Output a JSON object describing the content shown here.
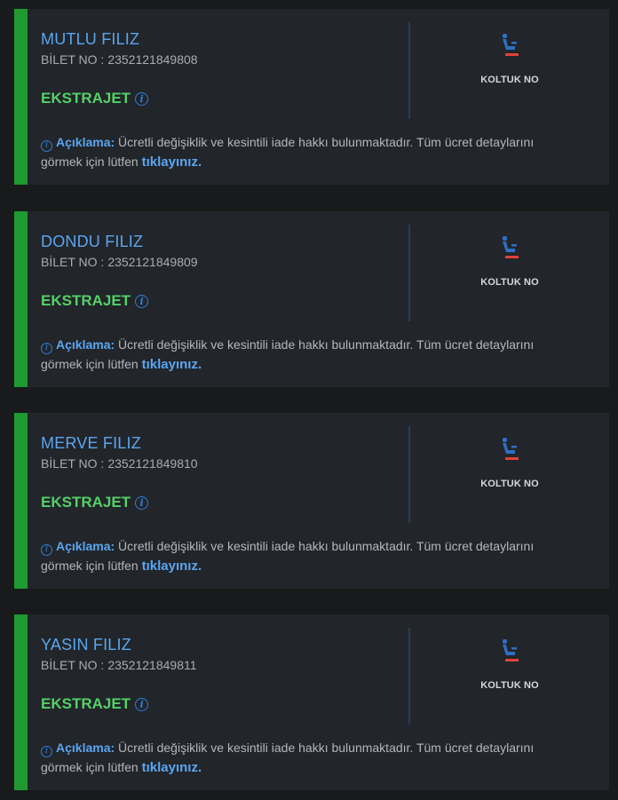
{
  "passengers": [
    {
      "name": "MUTLU FILIZ",
      "ticket_label": "BİLET NO :",
      "ticket_no": "2352121849808",
      "fare_class": "EKSTRAJET",
      "seat_label": "KOLTUK NO",
      "desc_title": "Açıklama:",
      "desc_text": "Ücretli değişiklik ve kesintili iade hakkı bulunmaktadır. Tüm ücret detaylarını görmek için lütfen",
      "desc_link": "tıklayınız."
    },
    {
      "name": "DONDU FILIZ",
      "ticket_label": "BİLET NO :",
      "ticket_no": "2352121849809",
      "fare_class": "EKSTRAJET",
      "seat_label": "KOLTUK NO",
      "desc_title": "Açıklama:",
      "desc_text": "Ücretli değişiklik ve kesintili iade hakkı bulunmaktadır. Tüm ücret detaylarını görmek için lütfen",
      "desc_link": "tıklayınız."
    },
    {
      "name": "MERVE FILIZ",
      "ticket_label": "BİLET NO :",
      "ticket_no": "2352121849810",
      "fare_class": "EKSTRAJET",
      "seat_label": "KOLTUK NO",
      "desc_title": "Açıklama:",
      "desc_text": "Ücretli değişiklik ve kesintili iade hakkı bulunmaktadır. Tüm ücret detaylarını görmek için lütfen",
      "desc_link": "tıklayınız."
    },
    {
      "name": "YASIN FILIZ",
      "ticket_label": "BİLET NO :",
      "ticket_no": "2352121849811",
      "fare_class": "EKSTRAJET",
      "seat_label": "KOLTUK NO",
      "desc_title": "Açıklama:",
      "desc_text": "Ücretli değişiklik ve kesintili iade hakkı bulunmaktadır. Tüm ücret detaylarını görmek için lütfen",
      "desc_link": "tıklayınız."
    }
  ],
  "icons": {
    "seat": "seat-icon",
    "info": "info-icon"
  },
  "colors": {
    "accent": "#1e9a30",
    "name": "#5aa6f0",
    "fare": "#53d167",
    "seat_icon": "#2f6fc4",
    "seat_icon_base": "#e0413b"
  }
}
